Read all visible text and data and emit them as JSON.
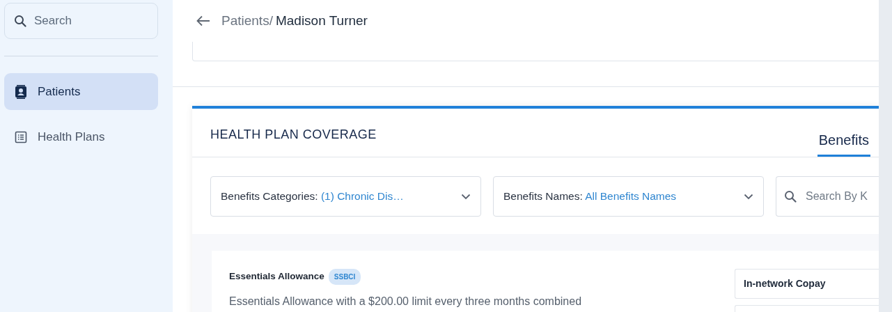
{
  "sidebar": {
    "search": {
      "placeholder": "Search"
    },
    "items": [
      {
        "label": "Patients",
        "kind": "patients",
        "selected": true
      },
      {
        "label": "Health Plans",
        "kind": "plans",
        "selected": false
      }
    ]
  },
  "breadcrumb": {
    "parent": "Patients/",
    "current": "Madison Turner"
  },
  "coverage": {
    "title": "HEALTH PLAN COVERAGE",
    "tabs": [
      {
        "label": "Benefits",
        "selected": true
      }
    ],
    "filters": [
      {
        "label": "Benefits Categories:",
        "value": "(1) Chronic Dis…"
      },
      {
        "label": "Benefits Names:",
        "value": "All Benefits Names"
      }
    ],
    "search": {
      "placeholder": "Search By K"
    },
    "benefits": [
      {
        "name": "Essentials Allowance",
        "tag": "SSBCI",
        "description": "Essentials Allowance with a $200.00 limit every three months combined",
        "cost_rows": [
          "In-network Copay"
        ]
      }
    ]
  }
}
